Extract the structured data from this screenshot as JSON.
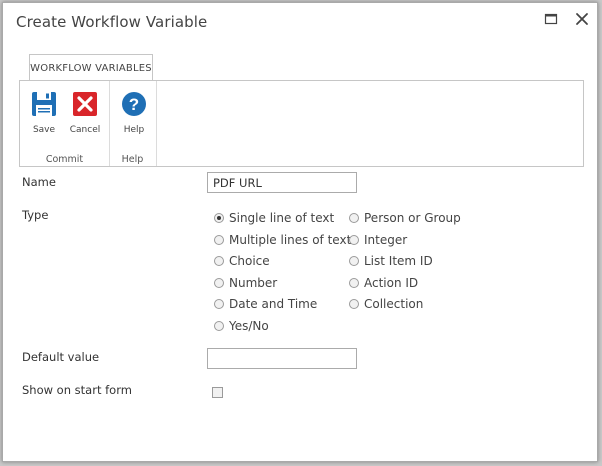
{
  "dialog": {
    "title": "Create Workflow Variable",
    "maximize_icon": "maximize-icon",
    "close_icon": "close-icon"
  },
  "ribbon": {
    "tab_label": "WORKFLOW VARIABLES",
    "groups": [
      {
        "label": "Commit",
        "buttons": [
          {
            "label": "Save",
            "icon": "floppy-disk-icon"
          },
          {
            "label": "Cancel",
            "icon": "red-x-icon"
          }
        ]
      },
      {
        "label": "Help",
        "buttons": [
          {
            "label": "Help",
            "icon": "question-mark-icon"
          }
        ]
      }
    ]
  },
  "form": {
    "name_label": "Name",
    "name_value": "PDF URL",
    "type_label": "Type",
    "type_options": [
      {
        "label": "Single line of text",
        "checked": true
      },
      {
        "label": "Multiple lines of text",
        "checked": false
      },
      {
        "label": "Choice",
        "checked": false
      },
      {
        "label": "Number",
        "checked": false
      },
      {
        "label": "Date and Time",
        "checked": false
      },
      {
        "label": "Yes/No",
        "checked": false
      },
      {
        "label": "Person or Group",
        "checked": false
      },
      {
        "label": "Integer",
        "checked": false
      },
      {
        "label": "List Item ID",
        "checked": false
      },
      {
        "label": "Action ID",
        "checked": false
      },
      {
        "label": "Collection",
        "checked": false
      }
    ],
    "default_value_label": "Default value",
    "default_value": "",
    "show_on_start_label": "Show on start form",
    "show_on_start_checked": false
  },
  "colors": {
    "save_icon": "#1f6fb5",
    "cancel_icon": "#d9252a",
    "help_icon": "#1f6fb5"
  }
}
